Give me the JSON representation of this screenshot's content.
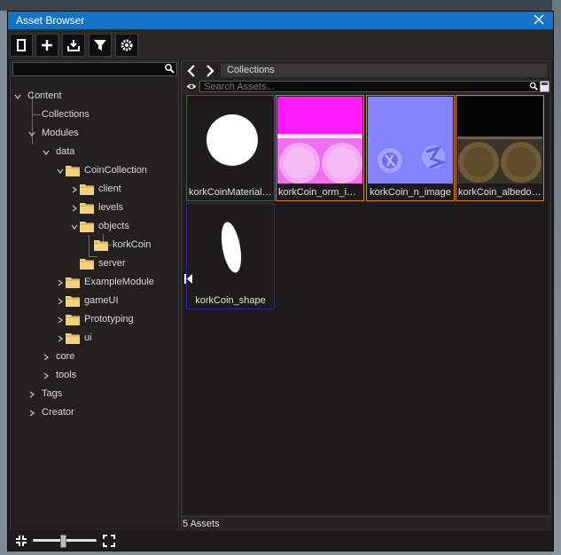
{
  "window": {
    "title": "Asset Browser"
  },
  "toolbar": {
    "buttons": [
      {
        "icon": "panel-toggle-icon"
      },
      {
        "icon": "plus-icon"
      },
      {
        "icon": "import-icon"
      },
      {
        "icon": "filter-icon"
      },
      {
        "icon": "gear-icon"
      }
    ]
  },
  "tree": {
    "search": {
      "value": "",
      "placeholder": ""
    },
    "nodes": [
      {
        "label": "Content"
      },
      {
        "label": "Collections"
      },
      {
        "label": "Modules"
      },
      {
        "label": "data"
      },
      {
        "label": "CoinCollection"
      },
      {
        "label": "client"
      },
      {
        "label": "levels"
      },
      {
        "label": "objects"
      },
      {
        "label": "korkCoin"
      },
      {
        "label": "server"
      },
      {
        "label": "ExampleModule"
      },
      {
        "label": "gameUI"
      },
      {
        "label": "Prototyping"
      },
      {
        "label": "ui"
      },
      {
        "label": "core"
      },
      {
        "label": "tools"
      },
      {
        "label": "Tags"
      },
      {
        "label": "Creator"
      }
    ]
  },
  "browser": {
    "breadcrumb": "Collections",
    "search_placeholder": "Search Assets...",
    "assets": [
      {
        "label": "korkCoinMaterial_...",
        "border": "#2f6b2f"
      },
      {
        "label": "korkCoin_orm_im...",
        "border": "#d7802a"
      },
      {
        "label": "korkCoin_n_image",
        "border": "#d7802a"
      },
      {
        "label": "korkCoin_albedo_...",
        "border": "#d7802a"
      },
      {
        "label": "korkCoin_shape",
        "border": "#2626a8"
      }
    ],
    "status": "5 Assets"
  },
  "colors": {
    "titlebar": "#1374c7",
    "folder": "#f3d27a",
    "orm_bg": "#ff00ff",
    "normal_bg": "#8080ff"
  }
}
